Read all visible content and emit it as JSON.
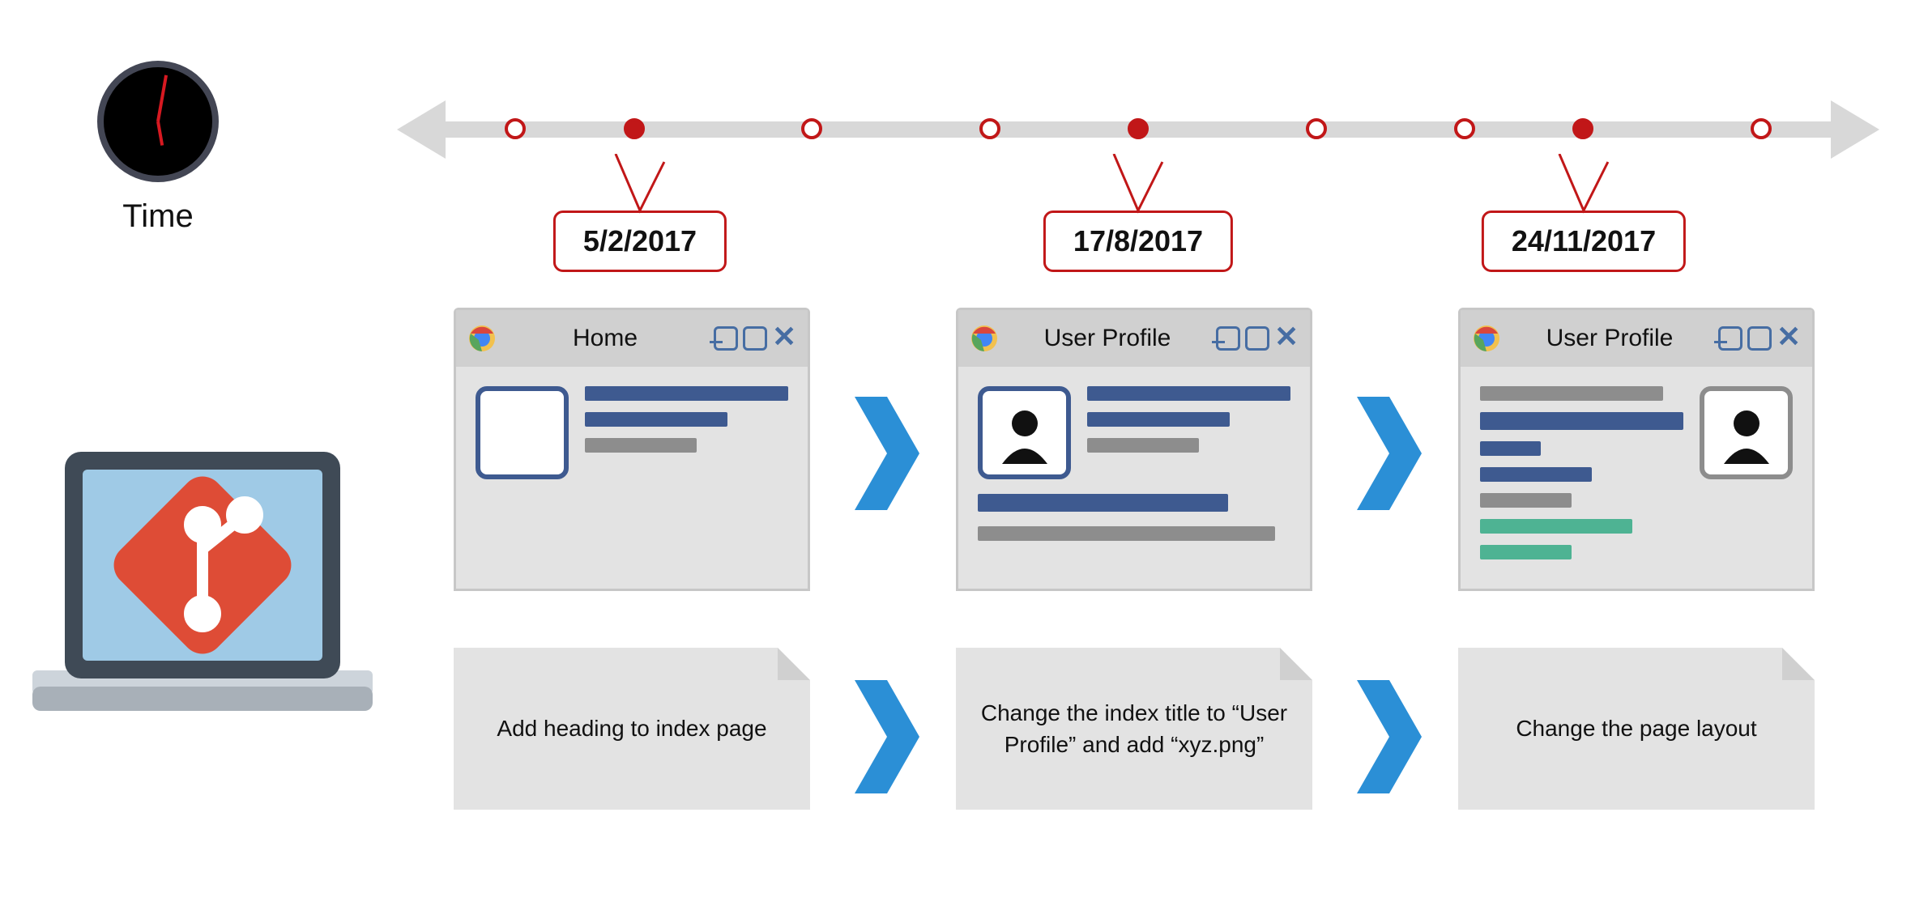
{
  "clock": {
    "label": "Time"
  },
  "timeline": {
    "callouts": [
      {
        "date": "5/2/2017"
      },
      {
        "date": "17/8/2017"
      },
      {
        "date": "24/11/2017"
      }
    ]
  },
  "snapshots": [
    {
      "title": "Home"
    },
    {
      "title": "User Profile"
    },
    {
      "title": "User Profile"
    }
  ],
  "notes": [
    "Add heading to index page",
    "Change the index title to “User Profile” and add “xyz.png”",
    "Change the page layout"
  ]
}
